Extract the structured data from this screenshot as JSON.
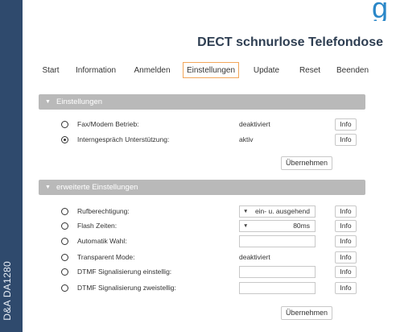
{
  "sidebar": {
    "text": "D&A DA1280"
  },
  "page_title": "DECT schnurlose Telefondose",
  "tabs": [
    {
      "label": "Start"
    },
    {
      "label": "Information"
    },
    {
      "label": "Anmelden"
    },
    {
      "label": "Einstellungen",
      "active": true
    },
    {
      "label": "Update"
    },
    {
      "label": "Reset"
    },
    {
      "label": "Beenden"
    }
  ],
  "section1": {
    "header": "Einstellungen",
    "rows": [
      {
        "label": "Fax/Modem Betrieb:",
        "value": "deaktiviert",
        "checked": false,
        "info": "Info"
      },
      {
        "label": "Interngespräch Unterstützung:",
        "value": "aktiv",
        "checked": true,
        "info": "Info"
      }
    ],
    "apply": "Übernehmen"
  },
  "section2": {
    "header": "erweiterte Einstellungen",
    "rows": [
      {
        "label": "Rufberechtigung:",
        "value": "ein- u. ausgehend",
        "info": "Info"
      },
      {
        "label": "Flash Zeiten:",
        "value": "80ms",
        "info": "Info"
      },
      {
        "label": "Automatik Wahl:",
        "value": "",
        "info": "Info"
      },
      {
        "label": "Transparent Mode:",
        "value": "deaktiviert",
        "info": "Info"
      },
      {
        "label": "DTMF Signalisierung einstellig:",
        "value": "",
        "info": "Info"
      },
      {
        "label": "DTMF Signalisierung zweistellig:",
        "value": "",
        "info": "Info"
      }
    ],
    "apply": "Übernehmen"
  },
  "colors": {
    "sidebar": "#2f4a6d",
    "section_header": "#b9b9b9",
    "active_tab_border": "#f2a65a",
    "title": "#2e3e52"
  }
}
